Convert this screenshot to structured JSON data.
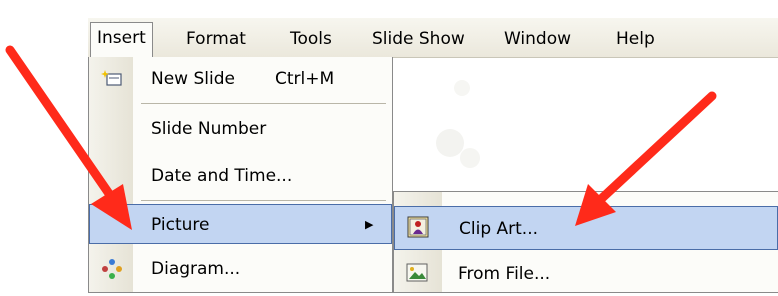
{
  "menubar": {
    "items": [
      "Insert",
      "Format",
      "Tools",
      "Slide Show",
      "Window",
      "Help"
    ]
  },
  "insert_menu": {
    "new_slide": {
      "label": "New Slide",
      "accel": "Ctrl+M"
    },
    "slide_number": "Slide Number",
    "date_and_time": "Date and Time...",
    "picture": "Picture",
    "diagram": "Diagram..."
  },
  "picture_submenu": {
    "clip_art": "Clip Art...",
    "from_file": "From File..."
  },
  "colors": {
    "highlight": "#c2d5f2",
    "highlight_border": "#4a6da8",
    "arrow": "#ff2a1a"
  },
  "icons": [
    "new-slide-icon",
    "submenu-arrow-icon",
    "diagram-icon",
    "clip-art-icon",
    "from-file-icon",
    "red-arrow-annotation"
  ]
}
